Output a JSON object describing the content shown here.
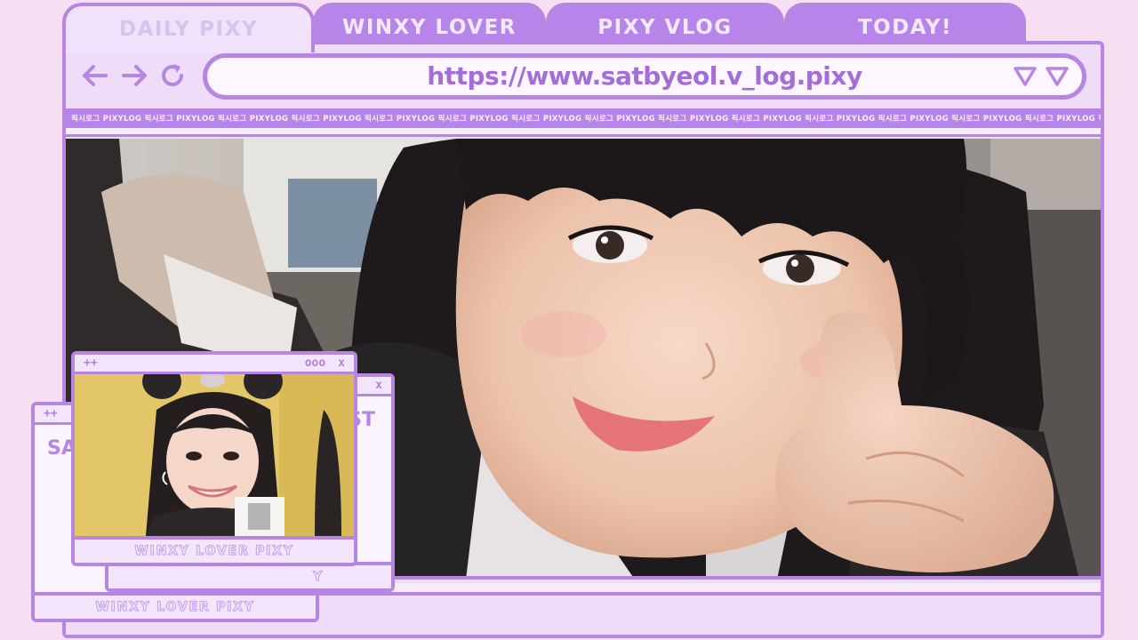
{
  "tabs": [
    {
      "label": "DAILY PIXY",
      "active": true
    },
    {
      "label": "WINXY LOVER",
      "active": false
    },
    {
      "label": "PIXY VLOG",
      "active": false
    },
    {
      "label": "TODAY!",
      "active": false
    }
  ],
  "nav": {
    "back_icon": "arrow-left-icon",
    "forward_icon": "arrow-right-icon",
    "reload_icon": "reload-icon"
  },
  "address_bar": {
    "url": "https://www.satbyeol.v_log.pixy",
    "dropdown_icons": [
      "triangle-down-icon",
      "triangle-down-icon"
    ]
  },
  "ticker": {
    "text": "픽시로그 PIXYLOG 픽시로그 PIXYLOG 픽시로그 PIXYLOG 픽시로그 PIXYLOG 픽시로그 PIXYLOG 픽시로그 PIXYLOG 픽시로그 PIXYLOG 픽시로그 PIXYLOG 픽시로그 PIXYLOG 픽시로그 PIXYLOG 픽시로그 PIXYLOG 픽시로그 PIXYLOG 픽시로그 PIXYLOG 픽시로그 PIXYLOG 픽시로그 PIXYLOG 픽시로그 PIXYLOG 픽시로그 PIXYLOG"
  },
  "popups": {
    "front": {
      "bar_left": "++",
      "bar_dots": "ooo",
      "bar_close": "x",
      "footer": "WINXY LOVER PIXY"
    },
    "middle": {
      "bar_close": "x",
      "partial_label": "ST",
      "partial_footer": "Y"
    },
    "back": {
      "bar_left": "++",
      "partial_label": "SA",
      "footer": "WINXY LOVER PIXY"
    }
  },
  "colors": {
    "accent": "#b785e2",
    "tab_inactive": "#b784ea",
    "background": "#f6dff2",
    "window": "#eedcf8"
  }
}
